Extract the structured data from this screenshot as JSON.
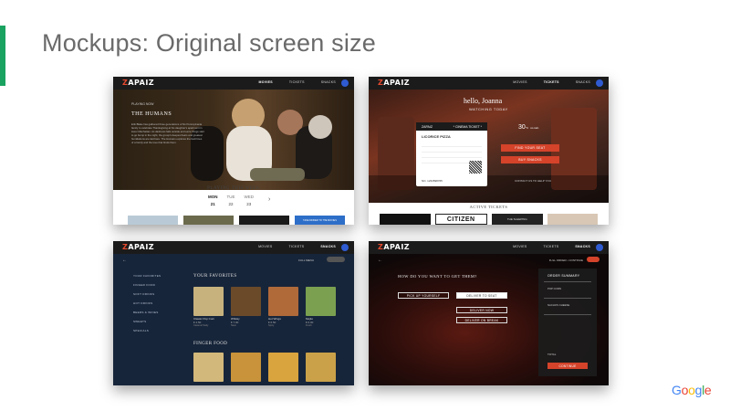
{
  "slide": {
    "title": "Mockups: Original screen size",
    "accent_color": "#1aa260",
    "footer_logo": [
      "G",
      "o",
      "o",
      "g",
      "l",
      "e"
    ]
  },
  "brand": {
    "logo": "ZAPAIZ",
    "accent": "#e84a2f"
  },
  "mock1": {
    "nav": [
      "MOVIES",
      "TICKETS",
      "SNACKS"
    ],
    "hero_caption": "PLAYING NOW",
    "hero_title": "THE HUMANS",
    "hero_desc": "Erik Blake has gathered three generations of his Pennsylvania family to celebrate Thanksgiving at his daughter's apartment in lower Manhattan. As darkness falls outside and eerie things start to go bump in the night, the group's deepest fears and greatest humiliations are laid bare. The Humans explores the fault lines of a family and the love that binds them.",
    "playing_title": "PLAYING THIS WEEK",
    "days": [
      {
        "name": "MON",
        "date": "21"
      },
      {
        "name": "TUE",
        "date": "22"
      },
      {
        "name": "WED",
        "date": "23"
      }
    ],
    "banner": "TAKE DINNER TO THE MOVIES"
  },
  "mock2": {
    "nav": [
      "MOVIES",
      "TICKETS",
      "SNACKS"
    ],
    "greeting": "hello, Joanna",
    "subtitle": "WATCHING TODAY",
    "ticket_brand": "ZAPAIZ",
    "ticket_label": "* CINEMA TICKET *",
    "ticket_movie": "LICORICE PIZZA",
    "ticket_no": "NO. 1234598765",
    "temperature": "30",
    "temp_unit": "°C",
    "temp_note": "no rain",
    "btn_find_seat": "FIND YOUR SEAT",
    "btn_snacks": "BUY SNACKS",
    "help": "CONTACT US TO HELP YOU",
    "active_tickets": "ACTIVE TICKETS",
    "poster_citizen": "CITIZEN",
    "poster_sleeping": "THE SLEEPING"
  },
  "mock3": {
    "nav": [
      "MOVIES",
      "TICKETS",
      "SNACKS"
    ],
    "filter": "FULL MENU",
    "menu": [
      "YOUR FAVORITES",
      "FINGER FOOD",
      "SOFT DRINKS",
      "HOT DRINKS",
      "BEERS & WINES",
      "SWEETS",
      "SPECIALS"
    ],
    "fav_title": "YOUR FAVORITES",
    "finger_title": "FINGER FOOD",
    "favorites": [
      {
        "name": "Classic Pop Corn",
        "price": "€ 4.50",
        "sub": "Caramel Salty"
      },
      {
        "name": "Whisky",
        "price": "€ 7.00",
        "sub": "Neat"
      },
      {
        "name": "Hot Wings",
        "price": "€ 6.50",
        "sub": "Spicy"
      },
      {
        "name": "Mojito",
        "price": "€ 6.00",
        "sub": "Fresh"
      }
    ]
  },
  "mock4": {
    "nav": [
      "MOVIES",
      "TICKETS",
      "SNACKS"
    ],
    "header_right": "FULL ORDER  •  CONTINUE",
    "question": "HOW DO YOU WANT TO GET THEM?",
    "opt_pickup": "PICK UP YOURSELF",
    "opt_deliver_seat": "DELIVER TO SEAT",
    "opt_deliver_now": "DELIVER NOW",
    "opt_deliver_break": "DELIVER ON BREAK",
    "order_title": "ORDER SUMMARY",
    "order_items": [
      "POP CORN",
      "NACHOS CHEESE"
    ],
    "total_label": "TOTAL",
    "continue": "CONTINUE"
  }
}
